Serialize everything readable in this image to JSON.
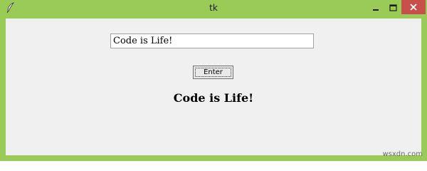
{
  "window": {
    "title": "tk",
    "icon": "feather-icon",
    "controls": {
      "minimize_icon": "minimize-icon",
      "maximize_icon": "maximize-icon",
      "close_icon": "close-icon"
    },
    "accent_color": "#9bcb57",
    "close_color": "#c7504a"
  },
  "form": {
    "entry_value": "Code is Life!",
    "button_label": "Enter",
    "output_text": "Code is Life!"
  },
  "watermark": "wsxdn.com"
}
